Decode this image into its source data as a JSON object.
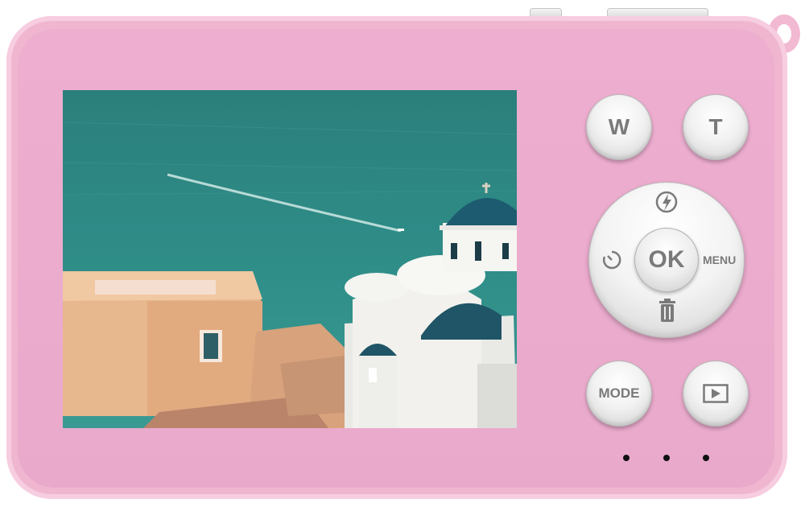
{
  "camera": {
    "color": "#f0b6d0",
    "buttons": {
      "wide_label": "W",
      "tele_label": "T",
      "ok_label": "OK",
      "menu_label": "MENU",
      "mode_label": "MODE"
    },
    "icons": {
      "flash": "flash-icon",
      "self_timer": "self-timer-icon",
      "delete": "trash-icon",
      "playback": "playback-icon"
    },
    "screen_image": "Santorini seaside view with blue-domed church and beige buildings above teal sea with a boat wake"
  }
}
